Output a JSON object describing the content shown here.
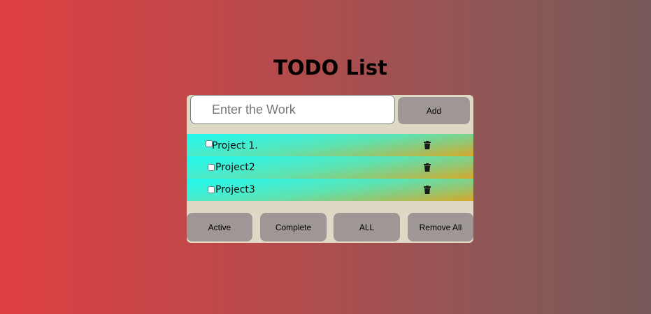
{
  "app": {
    "title": "TODO List"
  },
  "input": {
    "placeholder": "Enter the Work",
    "value": ""
  },
  "add_button": {
    "label": "Add"
  },
  "todos": [
    {
      "label": "Project 1.",
      "checked": false
    },
    {
      "label": "Project2",
      "checked": false
    },
    {
      "label": "Project3",
      "checked": false
    }
  ],
  "filters": {
    "active_label": "Active",
    "complete_label": "Complete",
    "all_label": "ALL",
    "remove_all_label": "Remove All"
  },
  "icons": {
    "delete": "trash-icon"
  },
  "colors": {
    "background_left": "#de3f41",
    "background_right": "#765a59",
    "card": "#ddd9c4",
    "button": "#9e9796",
    "item_cyan": "#1ff8ec",
    "item_gold": "#d6a82a"
  }
}
